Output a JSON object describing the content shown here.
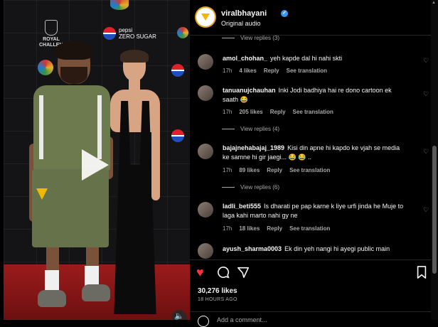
{
  "header": {
    "username": "viralbhayani",
    "audio": "Original audio"
  },
  "video": {
    "sponsor_pepsi": "pepsi",
    "sponsor_zero": "ZERO SUGAR",
    "sponsor_royal": "ROYAL CHALLENGE"
  },
  "comments": [
    {
      "type": "replies",
      "label": "View replies (3)"
    },
    {
      "type": "comment",
      "user": "amol_chohan_",
      "text": "yeh kapde dal hi nahi skti",
      "time": "17h",
      "likes": "4 likes",
      "reply": "Reply",
      "translate": "See translation"
    },
    {
      "type": "comment",
      "user": "tanuanujchauhan",
      "text": "Inki Jodi badhiya hai re dono cartoon ek saath 😂",
      "time": "17h",
      "likes": "205 likes",
      "reply": "Reply",
      "translate": "See translation"
    },
    {
      "type": "replies",
      "label": "View replies (4)"
    },
    {
      "type": "comment",
      "user": "bajajnehabajaj_1989",
      "text": "Kisi din apne hi kapdo ke vjah se media ke samne hi gir jaegi... 😂 😂 ..",
      "time": "17h",
      "likes": "89 likes",
      "reply": "Reply",
      "translate": "See translation"
    },
    {
      "type": "replies",
      "label": "View replies (6)"
    },
    {
      "type": "comment",
      "user": "ladli_beti555",
      "text": "Is dharati pe pap karne k liye urfi jinda he Muje to laga kahi marto nahi gy ne",
      "time": "17h",
      "likes": "18 likes",
      "reply": "Reply",
      "translate": "See translation"
    },
    {
      "type": "comment",
      "user": "ayush_sharma0003",
      "text": "Ek din yeh nangi hi ayegi public main"
    }
  ],
  "actions": {
    "like_count": "30,276 likes",
    "posted": "18 HOURS AGO",
    "add_comment_placeholder": "Add a comment..."
  },
  "colors": {
    "like_red": "#ff3040",
    "verified_blue": "#3897f0",
    "muted_text": "#a8a8a8"
  }
}
